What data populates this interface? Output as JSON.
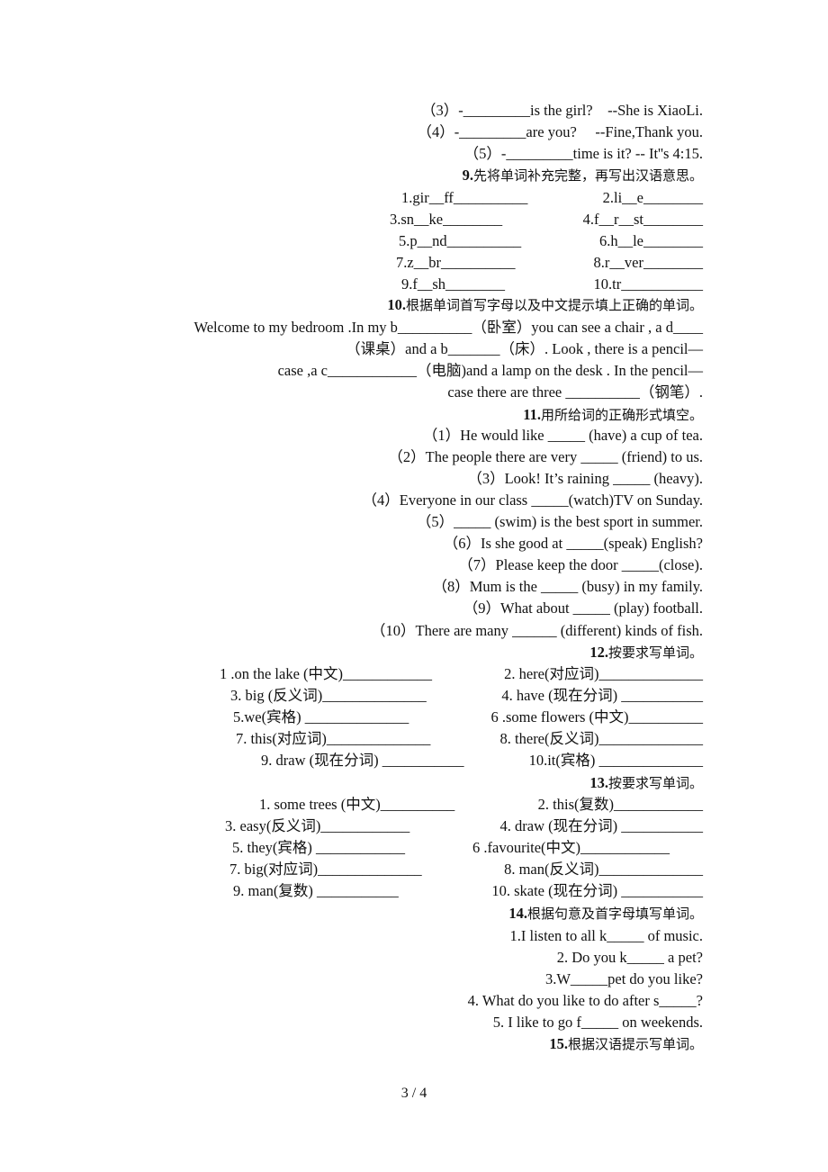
{
  "section8_tail": [
    "（3）-_________is the girl?    --She is XiaoLi.",
    "（4）-_________are you?     --Fine,Thank you.",
    "（5）-_________time is it? -- It''s 4:15."
  ],
  "section9": {
    "number": "9.",
    "title": "先将单词补充完整，再写出汉语意思。",
    "rows": [
      [
        "1.gir__ff__________",
        "2.li__e________"
      ],
      [
        "3.sn__ke________",
        "4.f__r__st________"
      ],
      [
        "5.p__nd__________",
        "6.h__le________"
      ],
      [
        "7.z__br__________",
        "8.r__ver________"
      ],
      [
        "9.f__sh________",
        "10.tr___________"
      ]
    ]
  },
  "section10": {
    "number": "10.",
    "title": "根据单词首写字母以及中文提示填上正确的单词。",
    "lines": [
      "Welcome to my bedroom .In my b__________（卧室）you can see a chair , a d____",
      "（课桌）and a b_______（床）. Look , there is a pencil—",
      "case ,a c____________（电脑)and a lamp on the desk . In the pencil—",
      "case there are three __________（钢笔）."
    ]
  },
  "section11": {
    "number": "11.",
    "title": "用所给词的正确形式填空。",
    "items": [
      "（1）He would like _____ (have) a cup of tea.",
      "（2）The people there are very _____ (friend) to us.",
      "（3）Look! It’s raining _____ (heavy).",
      "（4）Everyone in our class _____(watch)TV on Sunday.",
      "（5）_____ (swim) is the best sport in summer.",
      "（6）Is she good at _____(speak) English?",
      "（7）Please keep the door _____(close).",
      "（8）Mum is the _____ (busy) in my family.",
      "（9）What about _____ (play) football.",
      "（10）There are many ______ (different) kinds of fish."
    ]
  },
  "section12": {
    "number": "12.",
    "title": "按要求写单词。",
    "rows": [
      [
        "1 .on the lake (中文)____________",
        "2. here(对应词)______________"
      ],
      [
        "3. big (反义词)______________",
        "4. have (现在分词) ___________"
      ],
      [
        "5.we(宾格) ______________",
        "6 .some flowers (中文)__________"
      ],
      [
        "7. this(对应词)______________",
        "8. there(反义词)______________"
      ],
      [
        "9. draw (现在分词) ___________",
        "10.it(宾格) ______________"
      ]
    ]
  },
  "section13": {
    "number": "13.",
    "title": "按要求写单词。",
    "rows": [
      [
        "1. some trees (中文)__________",
        "2. this(复数)____________"
      ],
      [
        "3. easy(反义词)____________",
        "4. draw (现在分词) ___________"
      ],
      [
        "5. they(宾格) ____________",
        "6 .favourite(中文)____________"
      ],
      [
        "7. big(对应词)______________",
        "8. man(反义词)______________"
      ],
      [
        "9. man(复数) ___________",
        "10. skate (现在分词) ___________"
      ]
    ]
  },
  "section14": {
    "number": "14.",
    "title": "根据句意及首字母填写单词。",
    "items": [
      "1.I listen to all k_____ of music.",
      "2. Do you k_____ a pet?",
      "3.W_____pet do you like?",
      "4. What do you like to do after s_____?",
      "5. I like to go f_____ on weekends."
    ]
  },
  "section15": {
    "number": "15.",
    "title": "根据汉语提示写单词。"
  },
  "footer": {
    "page": "3 / 4"
  }
}
